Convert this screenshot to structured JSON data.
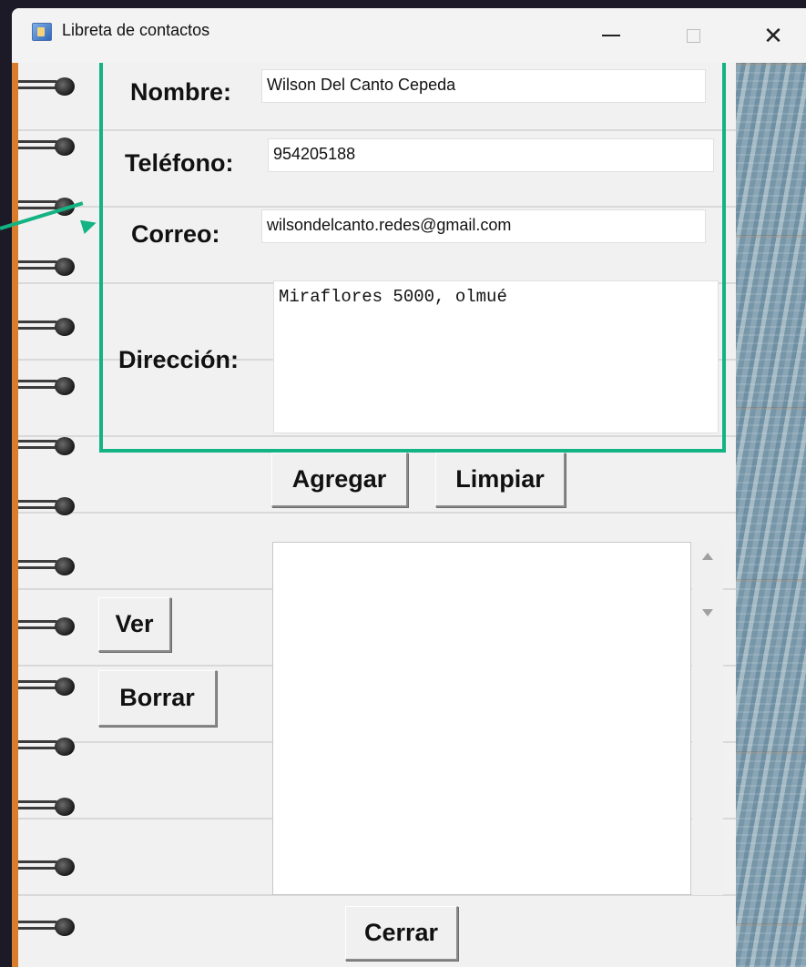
{
  "window": {
    "title": "Libreta de contactos",
    "controls": {
      "minimize": "minimize-icon",
      "maximize": "maximize-icon",
      "close": "close-icon"
    },
    "close_glyph": "✕"
  },
  "form": {
    "nombre": {
      "label": "Nombre:",
      "value": "Wilson Del Canto Cepeda"
    },
    "telefono": {
      "label": "Teléfono:",
      "value": "954205188"
    },
    "correo": {
      "label": "Correo:",
      "value": "wilsondelcanto.redes@gmail.com"
    },
    "direccion": {
      "label": "Dirección:",
      "value": "Miraflores 5000, olmué"
    }
  },
  "buttons": {
    "agregar": "Agregar",
    "limpiar": "Limpiar",
    "ver": "Ver",
    "borrar": "Borrar",
    "cerrar": "Cerrar"
  },
  "colors": {
    "highlight": "#14b383",
    "spiral_edge": "#d97c2c",
    "background": "#1b1a26"
  }
}
